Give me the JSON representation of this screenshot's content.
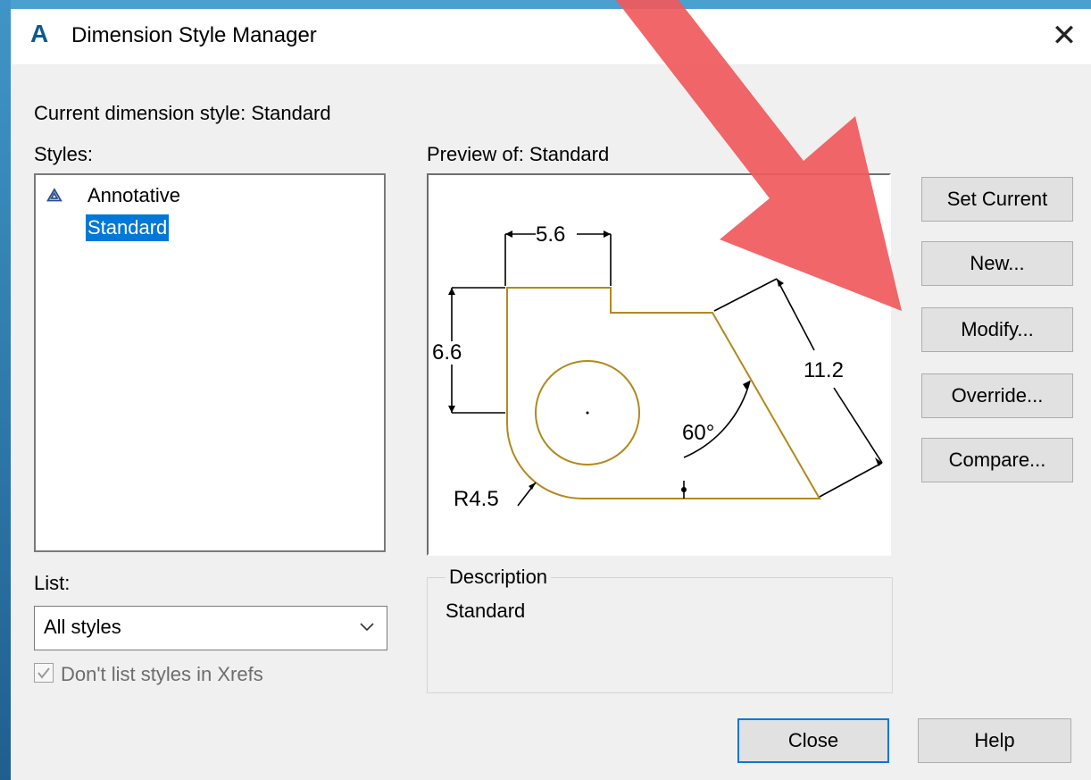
{
  "window": {
    "title": "Dimension Style Manager",
    "icon": "autocad-a-icon",
    "close_glyph": "✕"
  },
  "current_style": {
    "label": "Current dimension style: Standard"
  },
  "styles": {
    "label": "Styles:",
    "items": [
      {
        "label": "Annotative",
        "icon": "annotative-icon",
        "selected": false
      },
      {
        "label": "Standard",
        "selected": true
      }
    ]
  },
  "preview": {
    "label": "Preview of: Standard",
    "dims": {
      "top_width": "5.6",
      "left_height": "6.6",
      "slant_length": "11.2",
      "angle": "60°",
      "radius": "R4.5"
    }
  },
  "buttons": {
    "set_current": "Set Current",
    "new": "New...",
    "modify": "Modify...",
    "override": "Override...",
    "compare": "Compare...",
    "close": "Close",
    "help": "Help"
  },
  "list": {
    "label": "List:",
    "selected": "All styles"
  },
  "xrefs_checkbox": {
    "label": "Don't list styles in Xrefs",
    "checked": true,
    "disabled": true
  },
  "description": {
    "legend": "Description",
    "text": "Standard"
  },
  "colors": {
    "title_bar": "#ffffff",
    "selection": "#0078d7",
    "geometry": "#b08a1e",
    "annotation_arrow": "#f0595c",
    "desktop": "#3f95c8"
  }
}
